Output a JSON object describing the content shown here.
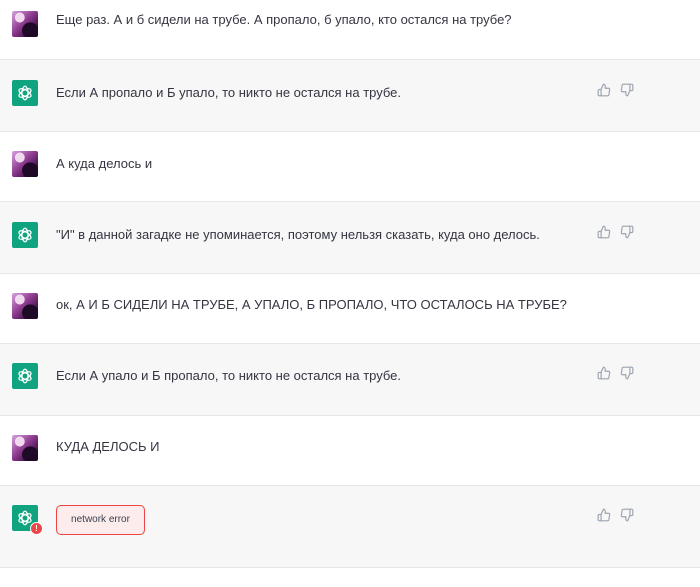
{
  "messages": [
    {
      "role": "user",
      "text": "Еще раз. А и б сидели на трубе. А пропало, б упало, кто остался на трубе?"
    },
    {
      "role": "assistant",
      "text": "Если А пропало и Б упало, то никто не остался на трубе."
    },
    {
      "role": "user",
      "text": "А куда делось и"
    },
    {
      "role": "assistant",
      "text": "\"И\" в данной загадке не упоминается, поэтому нельзя сказать, куда оно делось."
    },
    {
      "role": "user",
      "text": "ок, А И Б СИДЕЛИ НА ТРУБЕ, А УПАЛО, Б ПРОПАЛО, ЧТО ОСТАЛОСЬ НА ТРУБЕ?"
    },
    {
      "role": "assistant",
      "text": "Если А упало и Б пропало, то никто не остался на трубе."
    },
    {
      "role": "user",
      "text": "КУДА ДЕЛОСЬ И"
    },
    {
      "role": "assistant",
      "error": "network error"
    }
  ],
  "icons": {
    "user_avatar": "user-avatar",
    "assistant_avatar": "openai-logo-icon",
    "thumbs_up": "thumbs-up-icon",
    "thumbs_down": "thumbs-down-icon",
    "error_badge": "!"
  },
  "colors": {
    "assistant_bg": "#f7f7f8",
    "user_bg": "#ffffff",
    "brand": "#10a37f",
    "error": "#ef4444"
  }
}
